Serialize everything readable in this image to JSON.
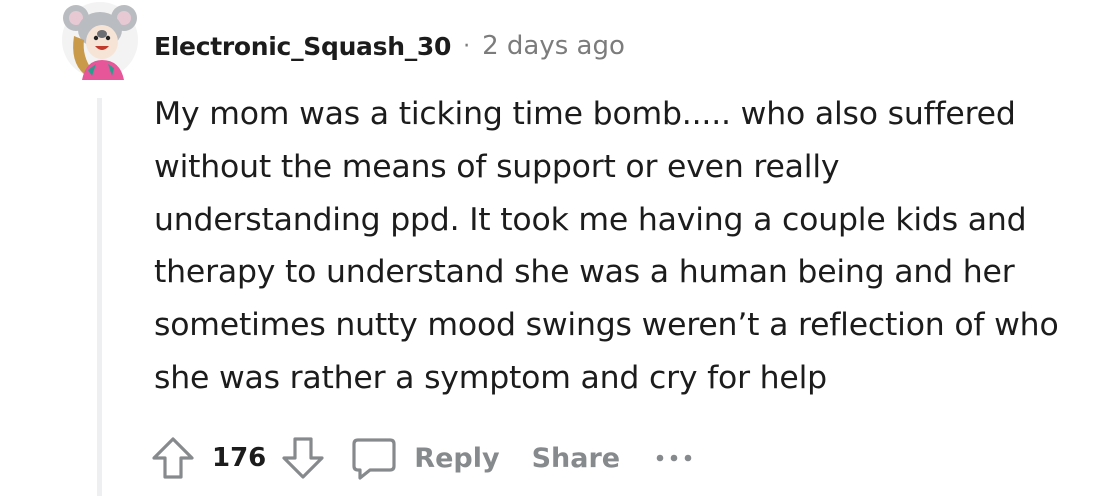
{
  "comment": {
    "author": "Electronic_Squash_30",
    "separator": "·",
    "timestamp": "2 days ago",
    "body_lines": [
      "My mom was a ticking time bomb..... who also suffered",
      "without the means of support or even really",
      "understanding ppd. It took me having a couple kids and",
      "therapy to understand she was a human being and her",
      "sometimes nutty mood swings weren’t a reflection of who",
      "she was rather a symptom and cry for help"
    ]
  },
  "actions": {
    "upvote_icon": "arrow-up-outline-icon",
    "vote_count": "176",
    "downvote_icon": "arrow-down-outline-icon",
    "reply_icon": "speech-bubble-icon",
    "reply_label": "Reply",
    "share_label": "Share",
    "more_icon": "ellipsis-icon"
  },
  "colors": {
    "text": "#1c1c1c",
    "meta_gray": "#7c7c7c",
    "action_gray": "#878a8c",
    "thread_line": "#edeff1"
  }
}
